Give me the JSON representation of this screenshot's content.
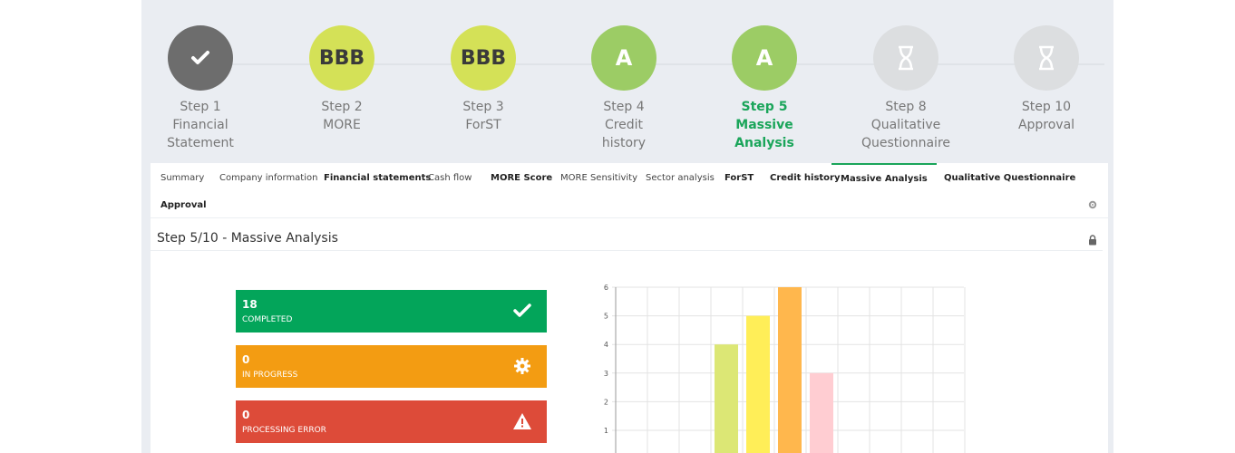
{
  "steps": [
    {
      "badge": "✔",
      "lines": [
        "Step 1",
        "Financial",
        "Statement"
      ],
      "style": "dark"
    },
    {
      "badge": "BBB",
      "lines": [
        "Step 2",
        "MORE",
        ""
      ],
      "style": "yellow"
    },
    {
      "badge": "BBB",
      "lines": [
        "Step 3",
        "ForST",
        ""
      ],
      "style": "yellow"
    },
    {
      "badge": "A",
      "lines": [
        "Step 4",
        "Credit",
        "history"
      ],
      "style": "green"
    },
    {
      "badge": "A",
      "lines": [
        "Step 5",
        "Massive",
        "Analysis"
      ],
      "style": "green",
      "active": true
    },
    {
      "badge": "⌛",
      "lines": [
        "Step 8",
        "Qualitative",
        "Questionnaire"
      ],
      "style": "grey"
    },
    {
      "badge": "⌛",
      "lines": [
        "Step 10",
        "Approval",
        ""
      ],
      "style": "grey"
    }
  ],
  "tabs": [
    {
      "label": "Summary",
      "bold": false
    },
    {
      "label": "Company information",
      "bold": false
    },
    {
      "label": "Financial statements",
      "bold": true
    },
    {
      "label": "Cash flow",
      "bold": false
    },
    {
      "label": "MORE Score",
      "bold": true
    },
    {
      "label": "MORE Sensitivity",
      "bold": false
    },
    {
      "label": "Sector analysis",
      "bold": false
    },
    {
      "label": "ForST",
      "bold": true
    },
    {
      "label": "Credit history",
      "bold": true
    },
    {
      "label": "Massive Analysis",
      "bold": true,
      "active": true
    },
    {
      "label": "Qualitative Questionnaire",
      "bold": true
    },
    {
      "label": "Approval",
      "bold": true
    }
  ],
  "page_title": "Step 5/10 - Massive Analysis",
  "stats": [
    {
      "value": "18",
      "label": "COMPLETED",
      "color": "#03a55a",
      "icon": "check-icon"
    },
    {
      "value": "0",
      "label": "IN PROGRESS",
      "color": "#f39c12",
      "icon": "gear-icon"
    },
    {
      "value": "0",
      "label": "PROCESSING ERROR",
      "color": "#dd4b39",
      "icon": "warning-icon"
    }
  ],
  "chart_data": {
    "type": "bar",
    "ylim": [
      0,
      6
    ],
    "yticks": [
      1,
      2,
      3,
      4,
      5,
      6
    ],
    "grid": true,
    "bars": [
      {
        "slot": 3,
        "value": 4,
        "color": "#dce775"
      },
      {
        "slot": 4,
        "value": 5,
        "color": "#ffee58"
      },
      {
        "slot": 5,
        "value": 6,
        "color": "#ffb74d"
      },
      {
        "slot": 6,
        "value": 3,
        "color": "#ffcdd2"
      }
    ]
  }
}
